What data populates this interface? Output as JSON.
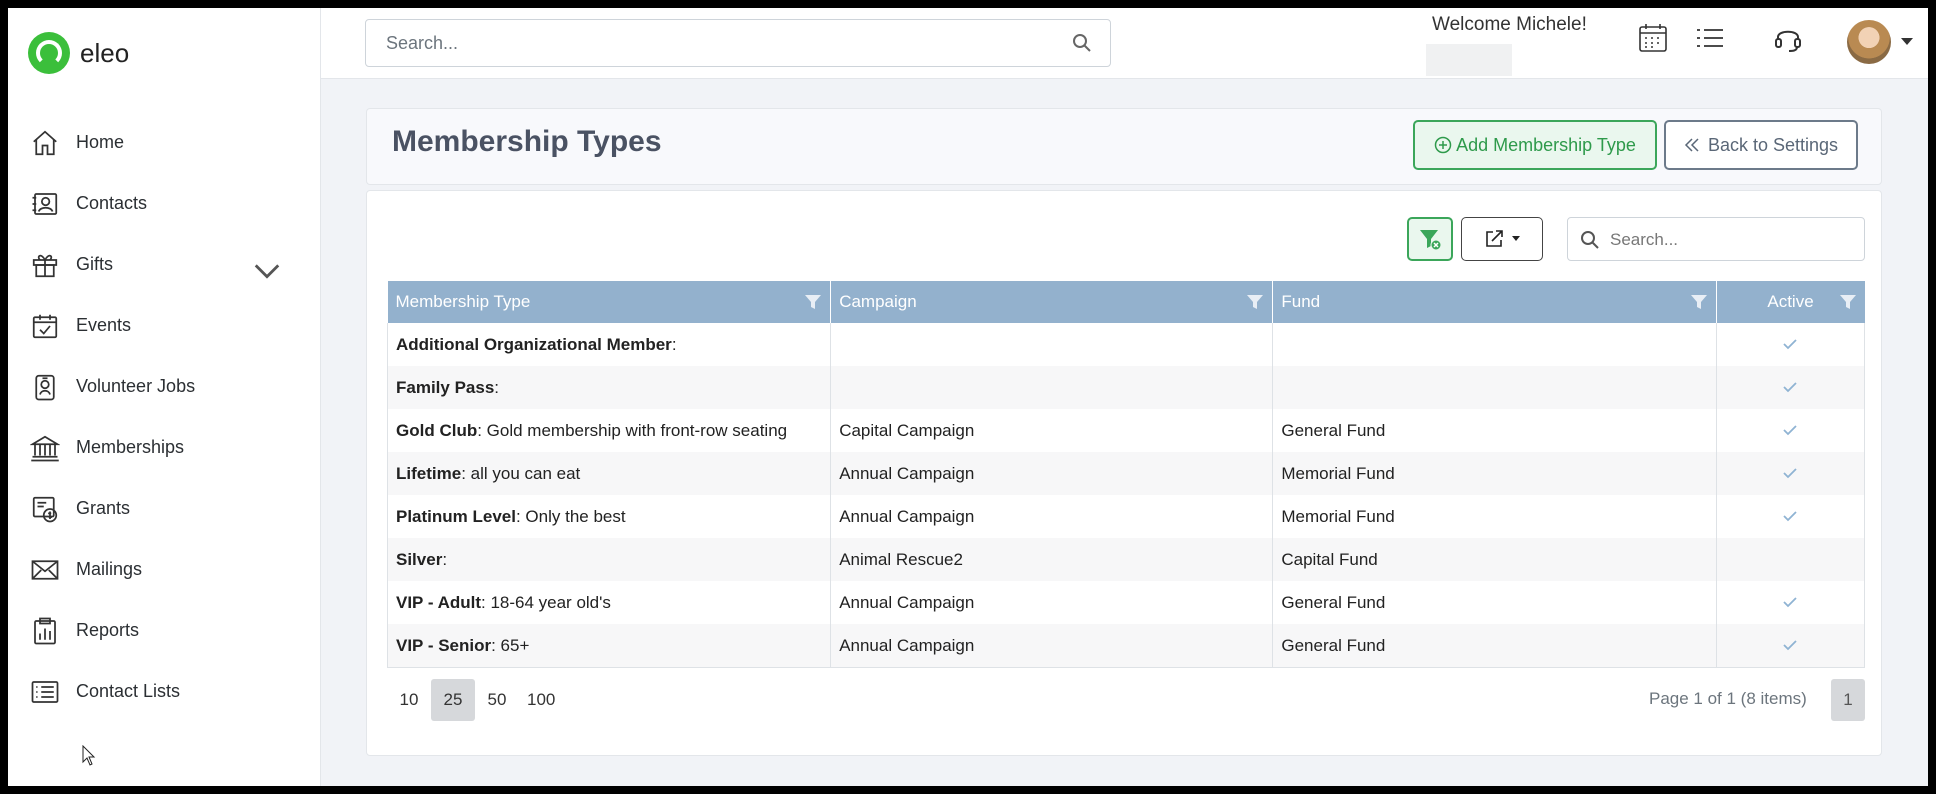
{
  "app": {
    "name": "eleo"
  },
  "sidebar": {
    "items": [
      {
        "label": "Home",
        "icon": "home-icon"
      },
      {
        "label": "Contacts",
        "icon": "contacts-icon"
      },
      {
        "label": "Gifts",
        "icon": "gift-icon",
        "expandable": true
      },
      {
        "label": "Events",
        "icon": "calendar-check-icon"
      },
      {
        "label": "Volunteer Jobs",
        "icon": "badge-icon"
      },
      {
        "label": "Memberships",
        "icon": "bank-icon"
      },
      {
        "label": "Grants",
        "icon": "grant-icon"
      },
      {
        "label": "Mailings",
        "icon": "envelope-icon"
      },
      {
        "label": "Reports",
        "icon": "clipboard-chart-icon"
      },
      {
        "label": "Contact Lists",
        "icon": "list-icon"
      }
    ]
  },
  "header": {
    "search_placeholder": "Search...",
    "welcome": "Welcome Michele!"
  },
  "page": {
    "title": "Membership Types",
    "add_button": "Add Membership Type",
    "back_button": "Back to Settings"
  },
  "grid": {
    "search_placeholder": "Search...",
    "columns": [
      "Membership Type",
      "Campaign",
      "Fund",
      "Active"
    ],
    "rows": [
      {
        "name": "Additional Organizational Member",
        "desc": ":",
        "campaign": "",
        "fund": "",
        "active": true
      },
      {
        "name": "Family Pass",
        "desc": ":",
        "campaign": "",
        "fund": "",
        "active": true
      },
      {
        "name": "Gold Club",
        "desc": ": Gold membership with front-row seating",
        "campaign": "Capital Campaign",
        "fund": "General Fund",
        "active": true
      },
      {
        "name": "Lifetime",
        "desc": ": all you can eat",
        "campaign": "Annual Campaign",
        "fund": "Memorial Fund",
        "active": true
      },
      {
        "name": "Platinum Level",
        "desc": ": Only the best",
        "campaign": "Annual Campaign",
        "fund": "Memorial Fund",
        "active": true
      },
      {
        "name": "Silver",
        "desc": ":",
        "campaign": "Animal Rescue2",
        "fund": "Capital Fund",
        "active": false
      },
      {
        "name": "VIP - Adult",
        "desc": ": 18-64 year old's",
        "campaign": "Annual Campaign",
        "fund": "General Fund",
        "active": true
      },
      {
        "name": "VIP - Senior",
        "desc": ": 65+",
        "campaign": "Annual Campaign",
        "fund": "General Fund",
        "active": true
      }
    ],
    "page_sizes": [
      "10",
      "25",
      "50",
      "100"
    ],
    "selected_page_size": "25",
    "page_info": "Page 1 of 1 (8 items)",
    "current_page": "1"
  },
  "colors": {
    "accent": "#3ba65a",
    "header_bg": "#93b1cd",
    "check": "#8fb3d3"
  }
}
